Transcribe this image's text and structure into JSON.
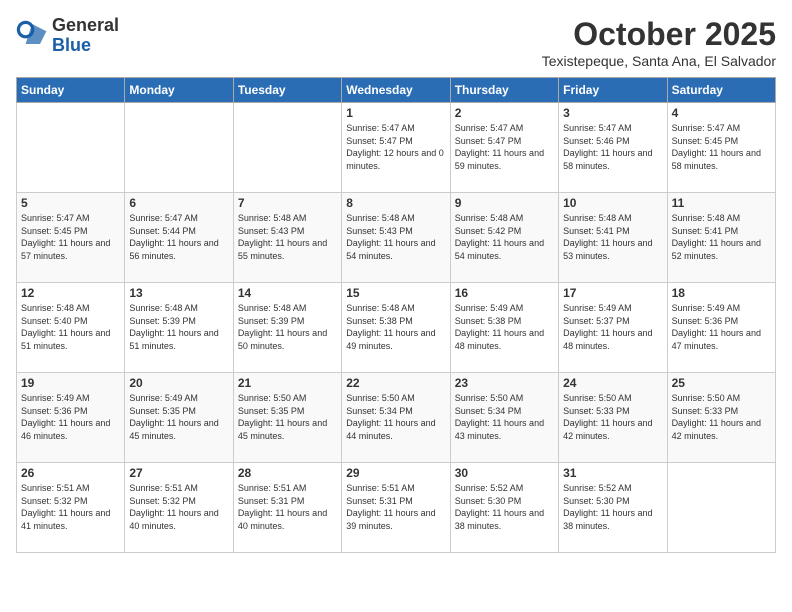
{
  "logo": {
    "general": "General",
    "blue": "Blue"
  },
  "title": "October 2025",
  "location": "Texistepeque, Santa Ana, El Salvador",
  "weekdays": [
    "Sunday",
    "Monday",
    "Tuesday",
    "Wednesday",
    "Thursday",
    "Friday",
    "Saturday"
  ],
  "weeks": [
    [
      {
        "day": "",
        "empty": true
      },
      {
        "day": "",
        "empty": true
      },
      {
        "day": "",
        "empty": true
      },
      {
        "day": "1",
        "sunrise": "5:47 AM",
        "sunset": "5:47 PM",
        "daylight": "12 hours and 0 minutes."
      },
      {
        "day": "2",
        "sunrise": "5:47 AM",
        "sunset": "5:47 PM",
        "daylight": "11 hours and 59 minutes."
      },
      {
        "day": "3",
        "sunrise": "5:47 AM",
        "sunset": "5:46 PM",
        "daylight": "11 hours and 58 minutes."
      },
      {
        "day": "4",
        "sunrise": "5:47 AM",
        "sunset": "5:45 PM",
        "daylight": "11 hours and 58 minutes."
      }
    ],
    [
      {
        "day": "5",
        "sunrise": "5:47 AM",
        "sunset": "5:45 PM",
        "daylight": "11 hours and 57 minutes."
      },
      {
        "day": "6",
        "sunrise": "5:47 AM",
        "sunset": "5:44 PM",
        "daylight": "11 hours and 56 minutes."
      },
      {
        "day": "7",
        "sunrise": "5:48 AM",
        "sunset": "5:43 PM",
        "daylight": "11 hours and 55 minutes."
      },
      {
        "day": "8",
        "sunrise": "5:48 AM",
        "sunset": "5:43 PM",
        "daylight": "11 hours and 54 minutes."
      },
      {
        "day": "9",
        "sunrise": "5:48 AM",
        "sunset": "5:42 PM",
        "daylight": "11 hours and 54 minutes."
      },
      {
        "day": "10",
        "sunrise": "5:48 AM",
        "sunset": "5:41 PM",
        "daylight": "11 hours and 53 minutes."
      },
      {
        "day": "11",
        "sunrise": "5:48 AM",
        "sunset": "5:41 PM",
        "daylight": "11 hours and 52 minutes."
      }
    ],
    [
      {
        "day": "12",
        "sunrise": "5:48 AM",
        "sunset": "5:40 PM",
        "daylight": "11 hours and 51 minutes."
      },
      {
        "day": "13",
        "sunrise": "5:48 AM",
        "sunset": "5:39 PM",
        "daylight": "11 hours and 51 minutes."
      },
      {
        "day": "14",
        "sunrise": "5:48 AM",
        "sunset": "5:39 PM",
        "daylight": "11 hours and 50 minutes."
      },
      {
        "day": "15",
        "sunrise": "5:48 AM",
        "sunset": "5:38 PM",
        "daylight": "11 hours and 49 minutes."
      },
      {
        "day": "16",
        "sunrise": "5:49 AM",
        "sunset": "5:38 PM",
        "daylight": "11 hours and 48 minutes."
      },
      {
        "day": "17",
        "sunrise": "5:49 AM",
        "sunset": "5:37 PM",
        "daylight": "11 hours and 48 minutes."
      },
      {
        "day": "18",
        "sunrise": "5:49 AM",
        "sunset": "5:36 PM",
        "daylight": "11 hours and 47 minutes."
      }
    ],
    [
      {
        "day": "19",
        "sunrise": "5:49 AM",
        "sunset": "5:36 PM",
        "daylight": "11 hours and 46 minutes."
      },
      {
        "day": "20",
        "sunrise": "5:49 AM",
        "sunset": "5:35 PM",
        "daylight": "11 hours and 45 minutes."
      },
      {
        "day": "21",
        "sunrise": "5:50 AM",
        "sunset": "5:35 PM",
        "daylight": "11 hours and 45 minutes."
      },
      {
        "day": "22",
        "sunrise": "5:50 AM",
        "sunset": "5:34 PM",
        "daylight": "11 hours and 44 minutes."
      },
      {
        "day": "23",
        "sunrise": "5:50 AM",
        "sunset": "5:34 PM",
        "daylight": "11 hours and 43 minutes."
      },
      {
        "day": "24",
        "sunrise": "5:50 AM",
        "sunset": "5:33 PM",
        "daylight": "11 hours and 42 minutes."
      },
      {
        "day": "25",
        "sunrise": "5:50 AM",
        "sunset": "5:33 PM",
        "daylight": "11 hours and 42 minutes."
      }
    ],
    [
      {
        "day": "26",
        "sunrise": "5:51 AM",
        "sunset": "5:32 PM",
        "daylight": "11 hours and 41 minutes."
      },
      {
        "day": "27",
        "sunrise": "5:51 AM",
        "sunset": "5:32 PM",
        "daylight": "11 hours and 40 minutes."
      },
      {
        "day": "28",
        "sunrise": "5:51 AM",
        "sunset": "5:31 PM",
        "daylight": "11 hours and 40 minutes."
      },
      {
        "day": "29",
        "sunrise": "5:51 AM",
        "sunset": "5:31 PM",
        "daylight": "11 hours and 39 minutes."
      },
      {
        "day": "30",
        "sunrise": "5:52 AM",
        "sunset": "5:30 PM",
        "daylight": "11 hours and 38 minutes."
      },
      {
        "day": "31",
        "sunrise": "5:52 AM",
        "sunset": "5:30 PM",
        "daylight": "11 hours and 38 minutes."
      },
      {
        "day": "",
        "empty": true
      }
    ]
  ]
}
